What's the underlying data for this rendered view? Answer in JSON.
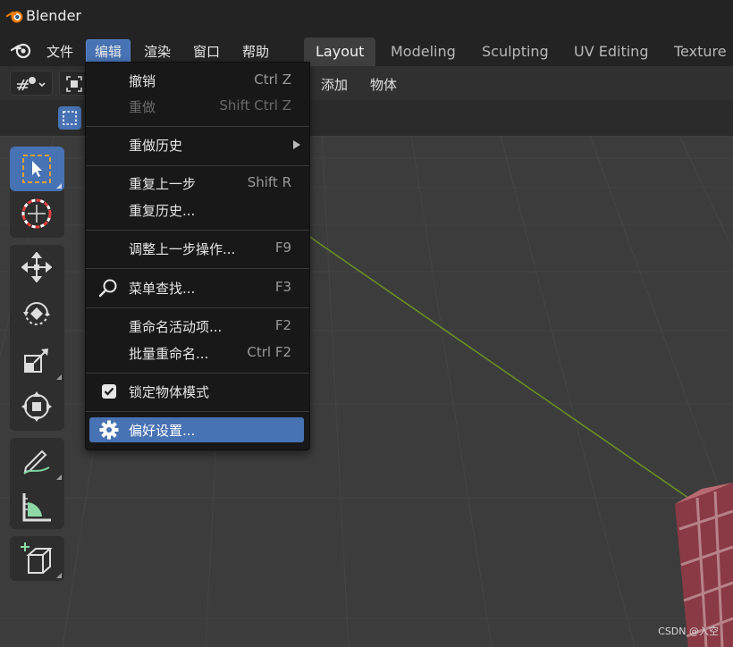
{
  "window": {
    "title": "Blender"
  },
  "menubar": {
    "items": [
      {
        "label": "文件"
      },
      {
        "label": "编辑"
      },
      {
        "label": "渲染"
      },
      {
        "label": "窗口"
      },
      {
        "label": "帮助"
      }
    ],
    "active_item": "编辑"
  },
  "workspace_tabs": [
    {
      "label": "Layout",
      "active": true
    },
    {
      "label": "Modeling"
    },
    {
      "label": "Sculpting"
    },
    {
      "label": "UV Editing"
    },
    {
      "label": "Texture"
    }
  ],
  "header": {
    "add_menu": "添加",
    "object_menu": "物体"
  },
  "edit_menu": {
    "items": [
      {
        "label": "撤销",
        "shortcut": "Ctrl Z"
      },
      {
        "label": "重做",
        "shortcut": "Shift Ctrl Z",
        "disabled": true
      },
      {
        "label": "重做历史",
        "submenu": true
      },
      {
        "label": "重复上一步",
        "shortcut": "Shift R"
      },
      {
        "label": "重复历史..."
      },
      {
        "label": "调整上一步操作...",
        "shortcut": "F9"
      },
      {
        "label": "菜单查找...",
        "shortcut": "F3",
        "icon": "search-icon"
      },
      {
        "label": "重命名活动项...",
        "shortcut": "F2"
      },
      {
        "label": "批量重命名...",
        "shortcut": "Ctrl F2"
      },
      {
        "label": "锁定物体模式",
        "checked": true,
        "icon": "checkbox-icon"
      },
      {
        "label": "偏好设置...",
        "highlighted": true,
        "icon": "gear-icon"
      }
    ]
  },
  "toolbar": {
    "tools": [
      {
        "icon": "select-box-icon",
        "active": true
      },
      {
        "icon": "cursor-icon"
      },
      {
        "icon": "move-icon"
      },
      {
        "icon": "rotate-icon"
      },
      {
        "icon": "scale-icon"
      },
      {
        "icon": "transform-icon"
      },
      {
        "icon": "annotate-icon"
      },
      {
        "icon": "measure-icon"
      },
      {
        "icon": "add-cube-icon"
      }
    ]
  },
  "watermark": "CSDN @入空",
  "colors": {
    "accent": "#4772b3",
    "menu_bg": "#181818",
    "viewport_bg": "#3c3c3c",
    "y_axis": "#6a8e23"
  }
}
